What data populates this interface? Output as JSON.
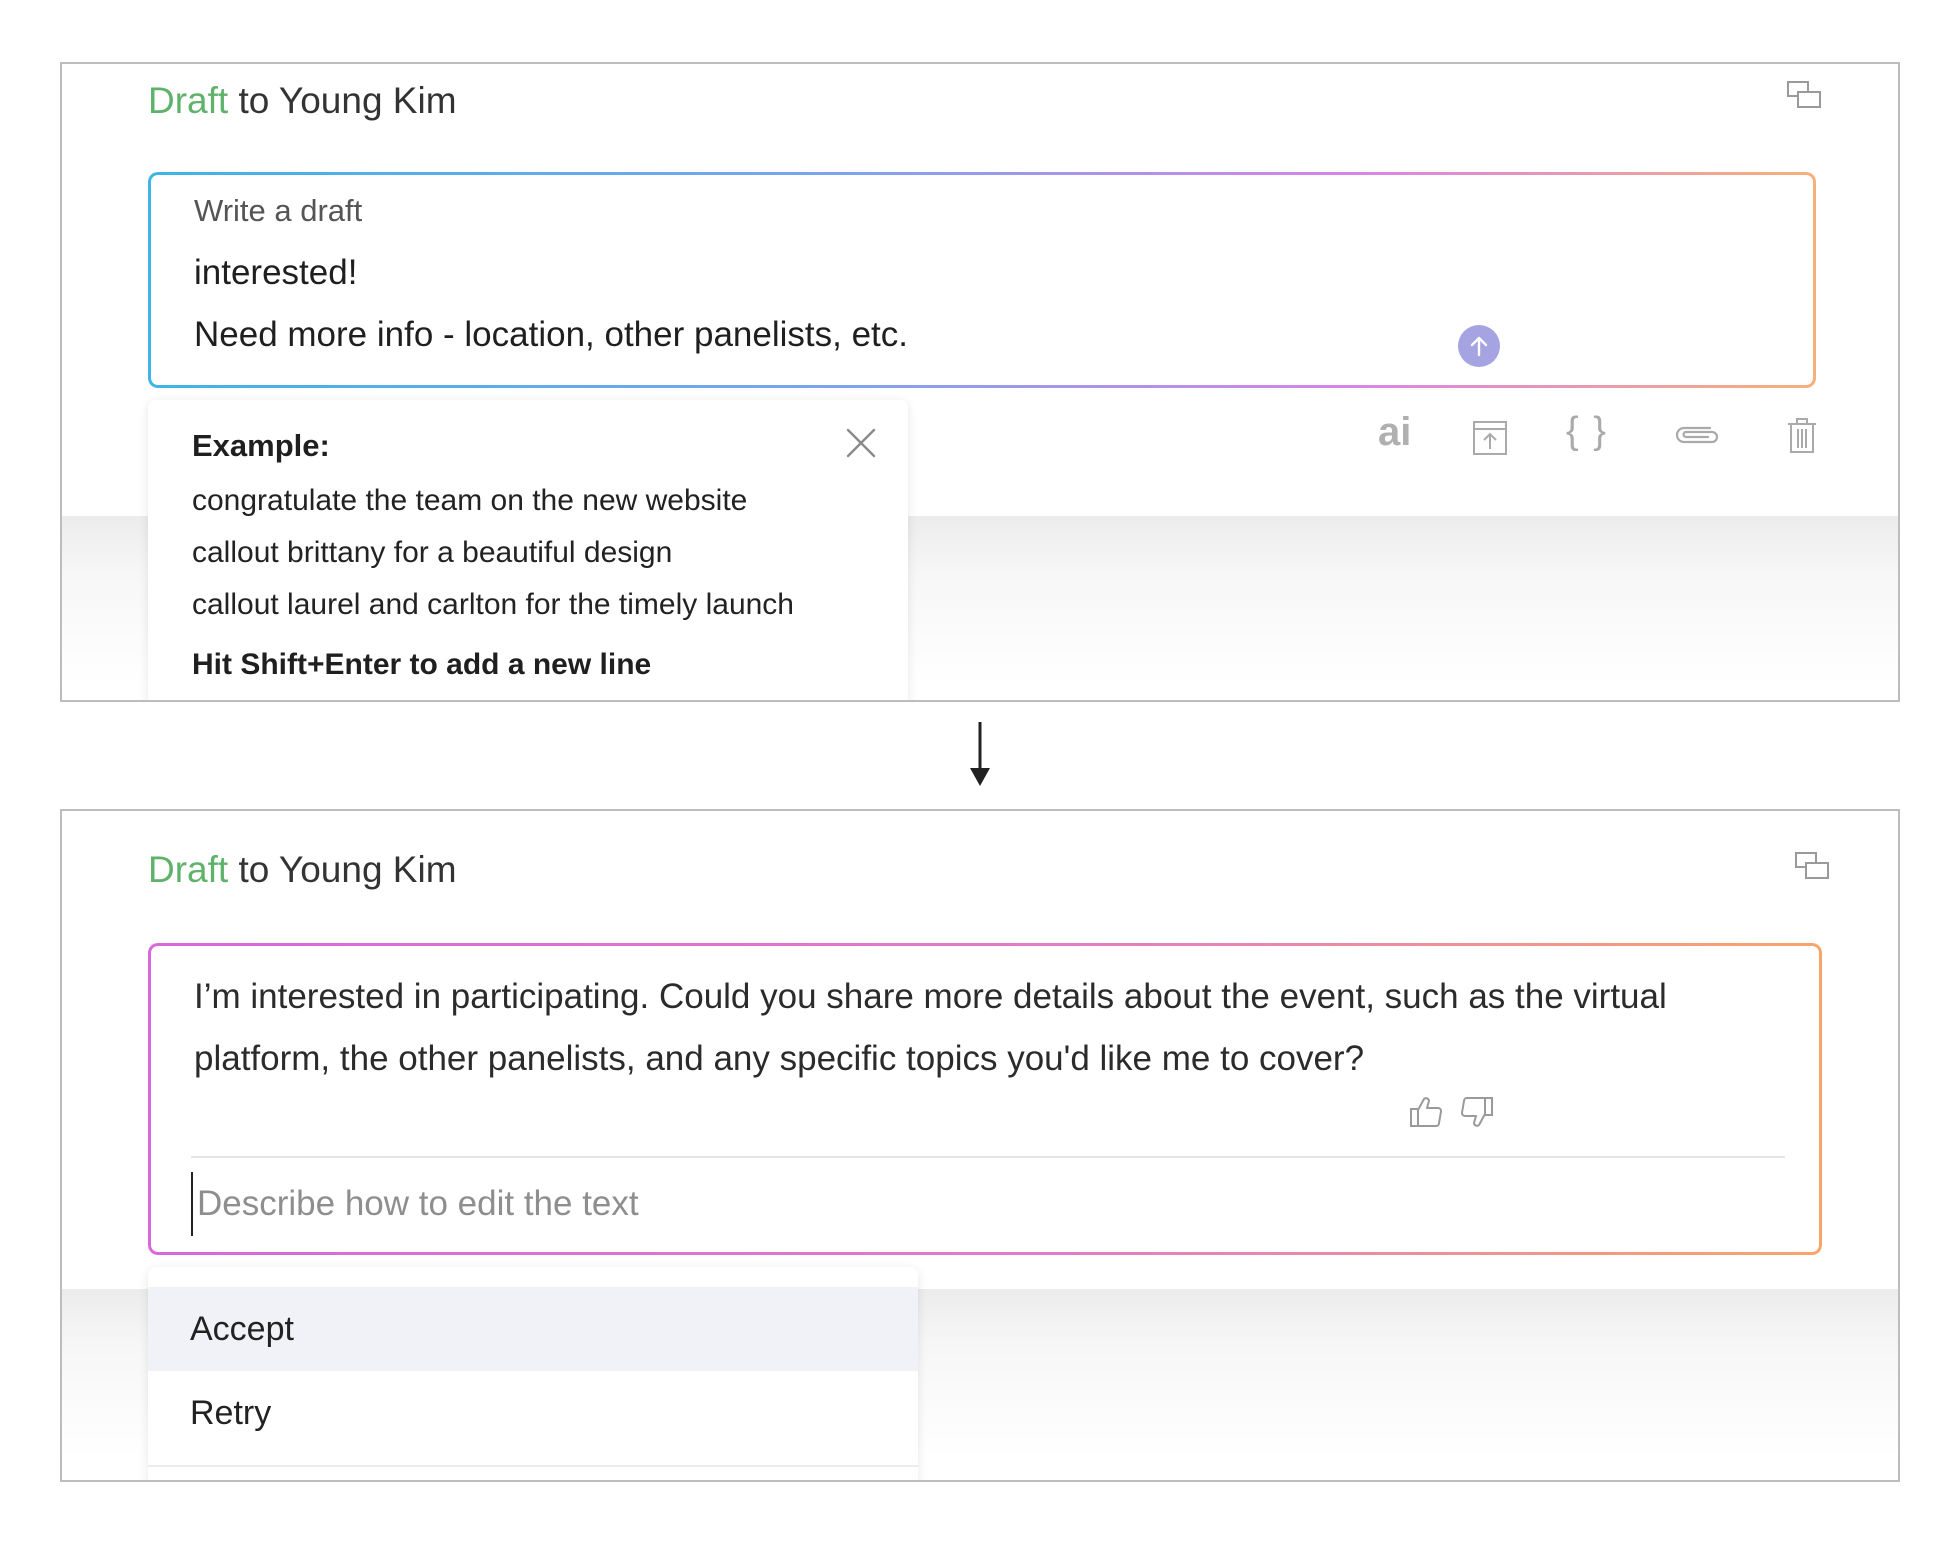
{
  "top_panel": {
    "title_accent": "Draft",
    "title_rest": " to Young Kim",
    "compose": {
      "label": "Write a draft",
      "lines": [
        "interested!",
        "Need more info - location, other panelists, etc."
      ]
    },
    "toolbar": {
      "ai_label": "ai",
      "braces_label": "{ }"
    },
    "example_popup": {
      "title": "Example:",
      "items": [
        "congratulate the team on the new website",
        "callout brittany for a beautiful design",
        "callout laurel and carlton for the timely launch"
      ],
      "hint": "Hit Shift+Enter to add a new line"
    }
  },
  "bottom_panel": {
    "title_accent": "Draft",
    "title_rest": " to Young Kim",
    "result_text": "I’m interested in participating. Could you share more details about the event, such as the virtual platform, the other panelists, and any specific topics you'd like me to cover?",
    "edit_input": {
      "value": "",
      "placeholder": "Describe how to edit the text"
    },
    "actions": [
      "Accept",
      "Retry"
    ]
  },
  "colors": {
    "accent_green": "#5fb26a",
    "send_button": "#a5a3e2",
    "compose_gradient": [
      "#3fb4e6",
      "#d784ea",
      "#f7b07a"
    ],
    "result_gradient": [
      "#d967dd",
      "#f9a56a"
    ]
  },
  "icons": [
    "popout-icon",
    "arrow-up-icon",
    "ai-icon",
    "upload-icon",
    "braces-icon",
    "paperclip-icon",
    "trash-icon",
    "close-icon",
    "arrow-down-icon",
    "thumbs-up-icon",
    "thumbs-down-icon"
  ]
}
